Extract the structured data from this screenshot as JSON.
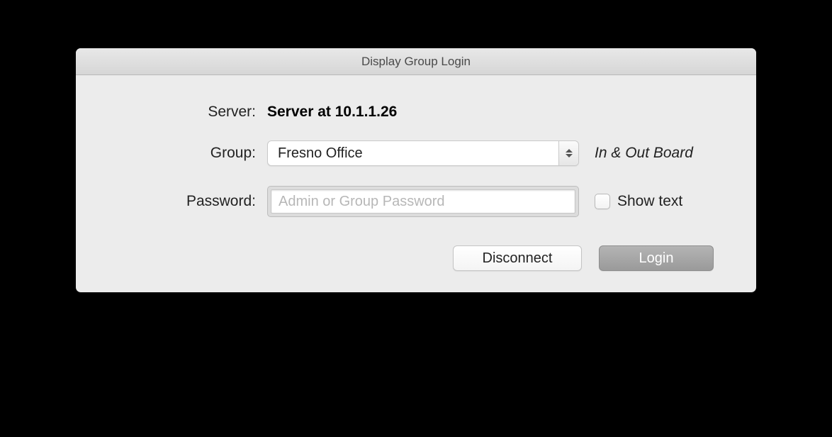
{
  "window": {
    "title": "Display Group Login"
  },
  "labels": {
    "server": "Server:",
    "group": "Group:",
    "password": "Password:"
  },
  "server": {
    "value": "Server at 10.1.1.26"
  },
  "group": {
    "selected": "Fresno Office",
    "description": "In & Out Board"
  },
  "password": {
    "placeholder": "Admin or Group Password",
    "value": "",
    "show_text_label": "Show text",
    "show_text_checked": false
  },
  "buttons": {
    "disconnect": "Disconnect",
    "login": "Login"
  }
}
